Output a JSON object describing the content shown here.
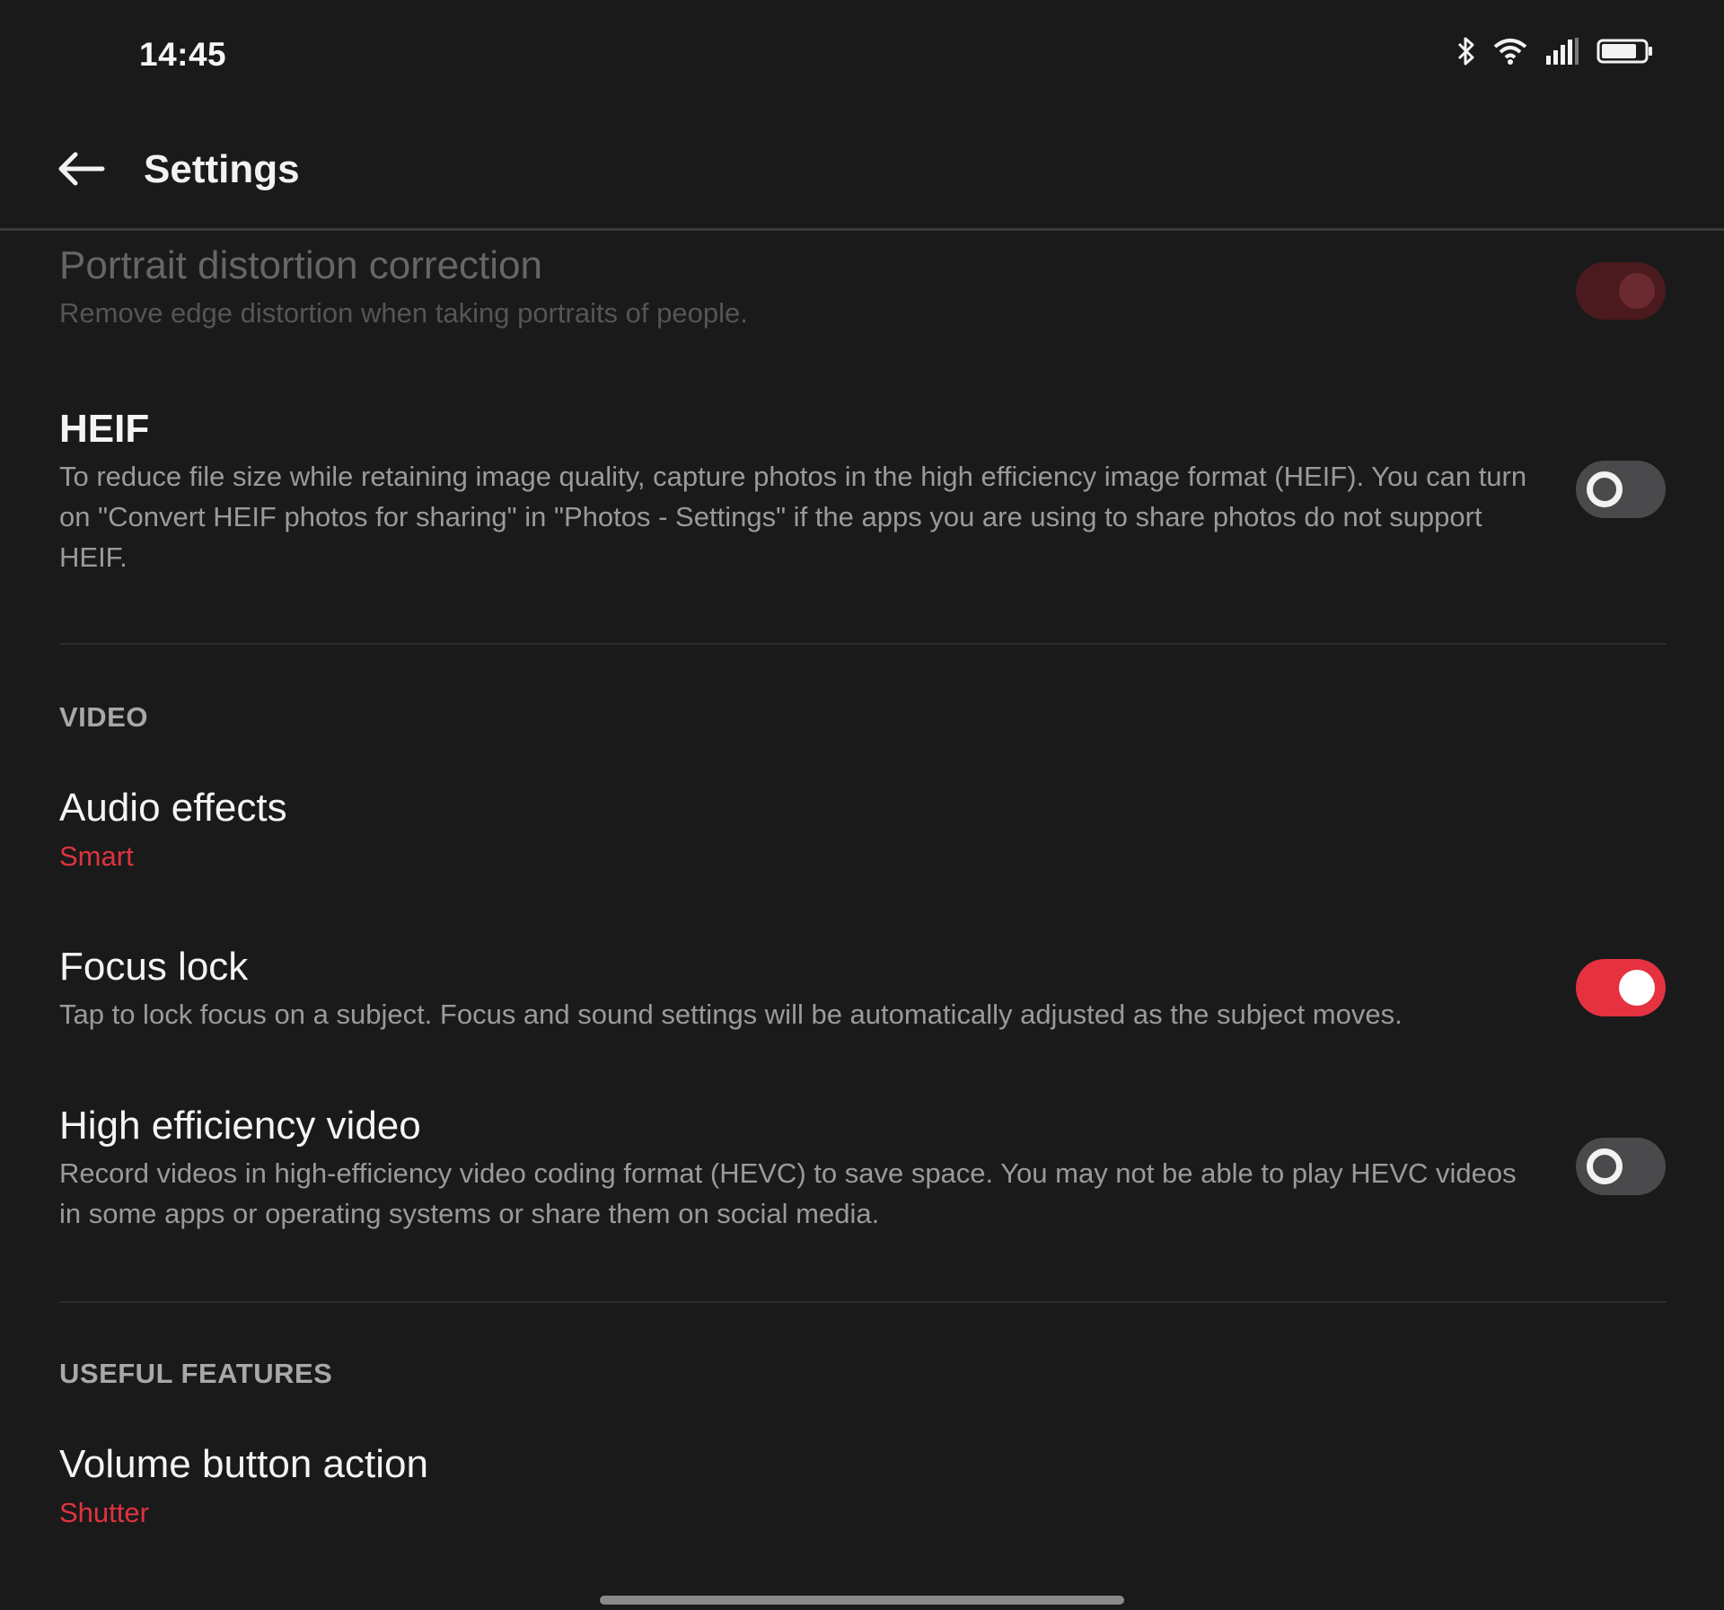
{
  "status_bar": {
    "time": "14:45",
    "icons": [
      "bluetooth-icon",
      "wifi-icon",
      "cellular-signal-icon",
      "battery-icon"
    ]
  },
  "app_bar": {
    "title": "Settings",
    "back_icon": "arrow-left-icon"
  },
  "colors": {
    "background": "#1a1a1b",
    "accent": "#e53140",
    "value_text": "#e0323f",
    "toggle_off": "#4a4a4c"
  },
  "settings": {
    "portrait": {
      "title": "Portrait distortion correction",
      "description": "Remove edge distortion when taking portraits of people.",
      "toggle": "on",
      "disabled": true
    },
    "heif": {
      "title": "HEIF",
      "description": "To reduce file size while retaining image quality, capture photos in the high efficiency image format (HEIF). You can turn on \"Convert HEIF photos for sharing\" in \"Photos - Settings\" if the apps you are using to share photos do not support HEIF.",
      "toggle": "off"
    }
  },
  "video_section": {
    "label": "VIDEO",
    "audio_effects": {
      "title": "Audio effects",
      "value": "Smart"
    },
    "focus_lock": {
      "title": "Focus lock",
      "description": "Tap to lock focus on a subject. Focus and sound settings will be automatically adjusted as the subject moves.",
      "toggle": "on"
    },
    "high_efficiency_video": {
      "title": "High efficiency video",
      "description": "Record videos in high-efficiency video coding format (HEVC) to save space. You may not be able to play HEVC videos in some apps or operating systems or share them on social media.",
      "toggle": "off"
    }
  },
  "useful_section": {
    "label": "USEFUL FEATURES",
    "volume_button_action": {
      "title": "Volume button action",
      "value": "Shutter"
    },
    "next_item_partial": {
      "title": ""
    }
  }
}
